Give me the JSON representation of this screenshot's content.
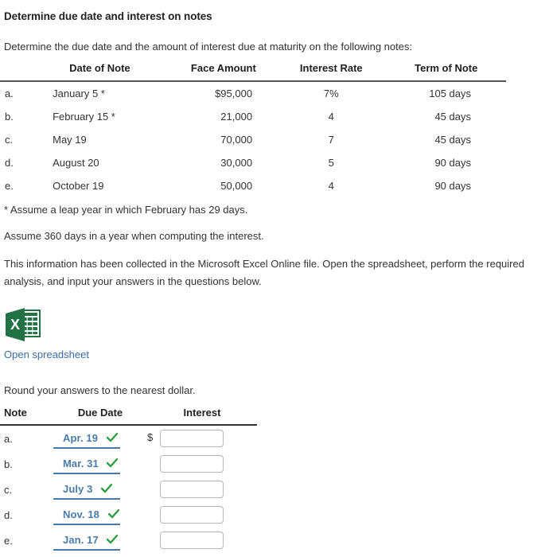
{
  "title": "Determine due date and interest on notes",
  "intro": "Determine the due date and the amount of interest due at maturity on the following notes:",
  "notes_table": {
    "headers": {
      "letter": "",
      "date_of_note": "Date of Note",
      "face_amount": "Face Amount",
      "interest_rate": "Interest Rate",
      "term_of_note": "Term of Note"
    },
    "rows": [
      {
        "letter": "a.",
        "date": "January 5 *",
        "face": "$95,000",
        "rate": "7%",
        "term": "105 days"
      },
      {
        "letter": "b.",
        "date": "February 15 *",
        "face": "21,000",
        "rate": "4",
        "term": "45 days"
      },
      {
        "letter": "c.",
        "date": "May 19",
        "face": "70,000",
        "rate": "7",
        "term": "45 days"
      },
      {
        "letter": "d.",
        "date": "August 20",
        "face": "30,000",
        "rate": "5",
        "term": "90 days"
      },
      {
        "letter": "e.",
        "date": "October 19",
        "face": "50,000",
        "rate": "4",
        "term": "90 days"
      }
    ]
  },
  "footnote_leap": "* Assume a leap year in which February has 29 days.",
  "footnote_360": "Assume 360 days in a year when computing the interest.",
  "excel_paragraph": "This information has been collected in the Microsoft Excel Online file. Open the spreadsheet, perform the required analysis, and input your answers in the questions below.",
  "spreadsheet": {
    "icon": "excel-icon",
    "link_label": "Open spreadsheet",
    "link_color": "#3a6ea5",
    "icon_green": "#217346"
  },
  "round_instruction": "Round your answers to the nearest dollar.",
  "answer_table": {
    "headers": {
      "note": "Note",
      "due_date": "Due Date",
      "interest": "Interest"
    },
    "due_date_color": "#4a7ba8",
    "check_color": "#2e9e3e",
    "rows": [
      {
        "letter": "a.",
        "due_date": "Apr. 19",
        "status": "correct",
        "currency": "$",
        "interest_value": "",
        "interest_placeholder": ""
      },
      {
        "letter": "b.",
        "due_date": "Mar. 31",
        "status": "correct",
        "currency": "",
        "interest_value": "",
        "interest_placeholder": ""
      },
      {
        "letter": "c.",
        "due_date": "July 3",
        "status": "correct",
        "currency": "",
        "interest_value": "",
        "interest_placeholder": ""
      },
      {
        "letter": "d.",
        "due_date": "Nov. 18",
        "status": "correct",
        "currency": "",
        "interest_value": "",
        "interest_placeholder": ""
      },
      {
        "letter": "e.",
        "due_date": "Jan. 17",
        "status": "correct",
        "currency": "",
        "interest_value": "",
        "interest_placeholder": ""
      }
    ]
  }
}
